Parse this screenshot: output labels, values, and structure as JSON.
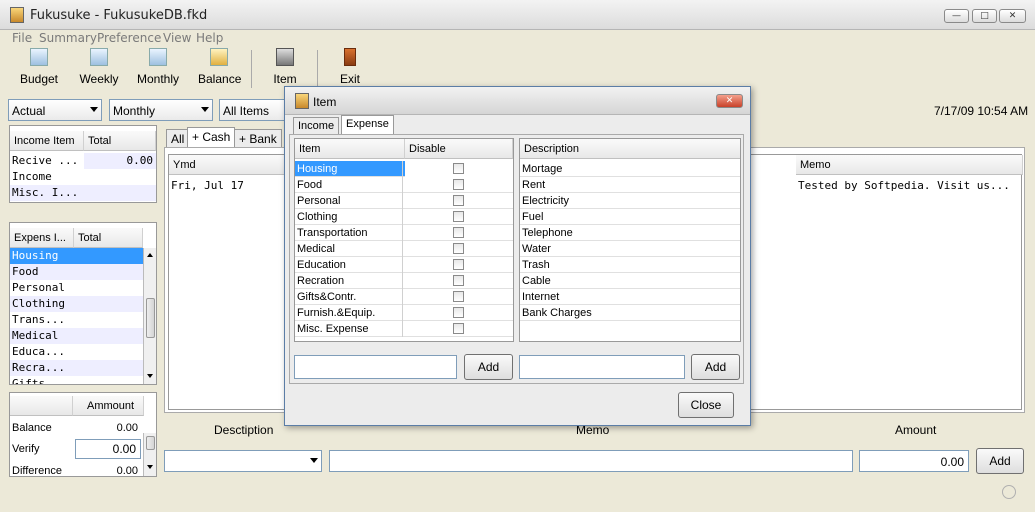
{
  "window": {
    "title": "Fukusuke - FukusukeDB.fkd"
  },
  "menu": [
    "File",
    "Summary",
    "Preference",
    "View",
    "Help"
  ],
  "toolbar": {
    "budget": "Budget",
    "weekly": "Weekly",
    "monthly": "Monthly",
    "balance": "Balance",
    "item": "Item",
    "exit": "Exit"
  },
  "filters": {
    "account": "Actual",
    "period": "Monthly",
    "items": "All Items"
  },
  "datetime": "7/17/09 10:54 AM",
  "income_table": {
    "headers": [
      "Income Item",
      "Total"
    ],
    "rows": [
      [
        "Recive ...",
        "0.00"
      ],
      [
        "Income",
        ""
      ],
      [
        "Misc. I...",
        ""
      ]
    ]
  },
  "expense_table": {
    "headers": [
      "Expens I...",
      "Total"
    ],
    "rows": [
      "Housing",
      "Food",
      "Personal",
      "Clothing",
      "Trans...",
      "Medical",
      "Educa...",
      "Recra...",
      "Gifts..."
    ]
  },
  "balance_table": {
    "header": "Ammount",
    "rows": [
      [
        "Balance",
        "0.00"
      ],
      [
        "Verify",
        "0.00"
      ],
      [
        "Difference",
        "0.00"
      ]
    ]
  },
  "main_tabs": [
    "All",
    "+ Cash",
    "+ Bank"
  ],
  "transactions": {
    "headers": {
      "ymd": "Ymd",
      "memo": "Memo"
    },
    "row": {
      "date": "Fri, Jul 17",
      "memo": "Tested by Softpedia. Visit us..."
    }
  },
  "entry": {
    "description_label": "Desctiption",
    "memo_label": "Memo",
    "amount_label": "Amount",
    "amount_value": "0.00",
    "add": "Add"
  },
  "dialog": {
    "title": "Item",
    "tabs": [
      "Income",
      "Expense"
    ],
    "items_headers": [
      "Item",
      "Disable"
    ],
    "items": [
      "Housing",
      "Food",
      "Personal",
      "Clothing",
      "Transportation",
      "Medical",
      "Education",
      "Recration",
      "Gifts&Contr.",
      "Furnish.&Equip.",
      "Misc. Expense"
    ],
    "desc_header": "Description",
    "descriptions": [
      "Mortage",
      "Rent",
      "Electricity",
      "Fuel",
      "Telephone",
      "Water",
      "Trash",
      "Cable",
      "Internet",
      "Bank Charges"
    ],
    "add": "Add",
    "close": "Close"
  },
  "colors": {
    "selection": "#3399ff",
    "stripe": "#eeeeff",
    "background": "#ece9d8"
  }
}
